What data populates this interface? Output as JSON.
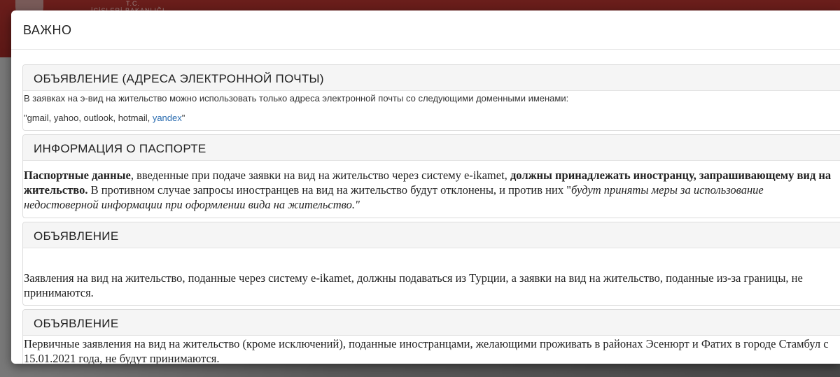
{
  "modal": {
    "title": "ВАЖНО",
    "panels": [
      {
        "title": "ОБЪЯВЛЕНИЕ (АДРЕСА ЭЛЕКТРОННОЙ ПОЧТЫ)",
        "line1": "В заявках на э-вид на жительство можно использовать только адреса электронной почты со следующими доменными именами:",
        "domains_prefix": "\"gmail, yahoo, outlook, hotmail, ",
        "domains_link": "yandex",
        "domains_suffix": "\""
      },
      {
        "title": "ИНФОРМАЦИЯ О ПАСПОРТЕ",
        "bold1": "Паспортные данные",
        "text1": ", введенные при подаче заявки на вид на жительство через систему e-ikamet, ",
        "bold2": "должны принадлежать иностранцу, запрашивающему вид на жительство.",
        "text2": " В противном случае запросы иностранцев на вид на жительство будут отклонены, и против них \"",
        "italic": "будут приняты меры за использование недостоверной информации при оформлении вида на жительство.\""
      },
      {
        "title": "ОБЪЯВЛЕНИЕ",
        "text": "Заявления на вид на жительство, поданные через систему e-ikamet, должны подаваться из Турции, а заявки на вид на жительство, поданные из-за границы, не принимаются."
      },
      {
        "title": "ОБЪЯВЛЕНИЕ",
        "text": "Первичные заявления на вид на жительство (кроме исключений), поданные иностранцами, желающими проживать в районах Эсенюрт и Фатих в городе Стамбул с 15.01.2021 года, не будут принимаются."
      }
    ]
  },
  "background": {
    "ministry_line1": "T.C.",
    "ministry_line2": "İÇİŞLERİ BAKANLIĞI"
  }
}
